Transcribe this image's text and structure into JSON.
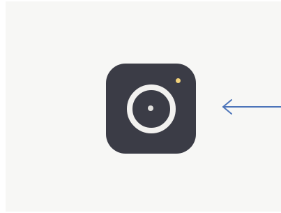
{
  "app_icon": {
    "name": "camera-app",
    "background_color": "#3b3c46",
    "lens_color": "#f2f1ef",
    "flash_color": "#f2d27a"
  },
  "pointer": {
    "direction": "left",
    "color": "#4c74b9"
  },
  "background_color": "#f7f7f5"
}
